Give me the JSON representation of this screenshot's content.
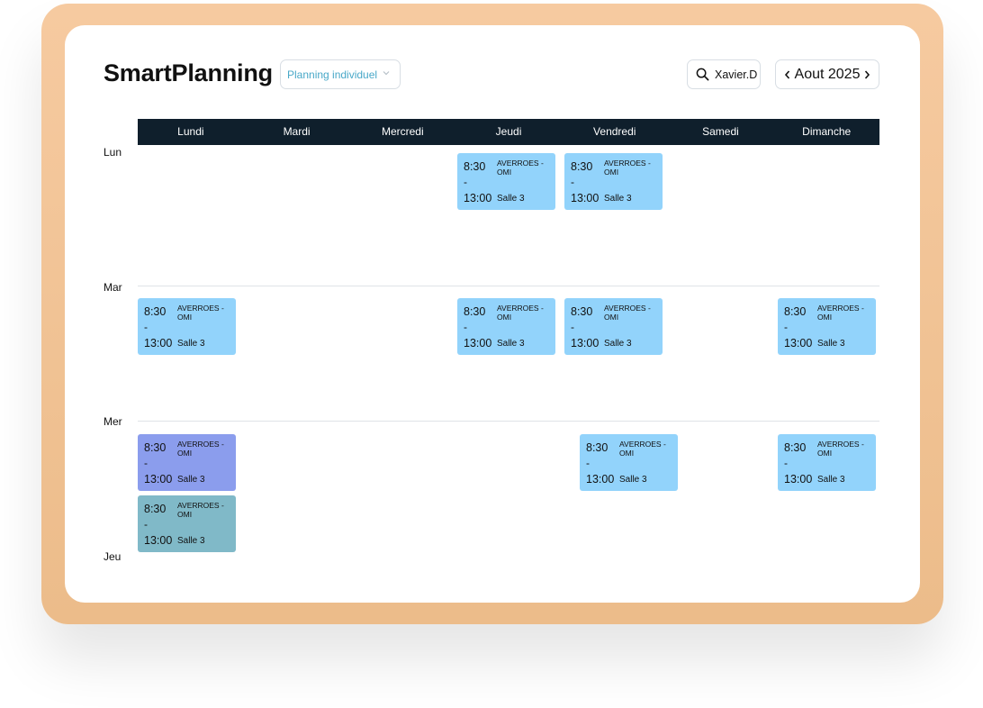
{
  "app": {
    "title": "SmartPlanning"
  },
  "view_select": {
    "selected": "Planning individuel"
  },
  "search": {
    "label": "Xavier.D",
    "icon": "search-icon"
  },
  "month_nav": {
    "label": "Aout 2025",
    "prev_icon": "chevron-left-icon",
    "next_icon": "chevron-right-icon"
  },
  "days": [
    "Lundi",
    "Mardi",
    "Mercredi",
    "Jeudi",
    "Vendredi",
    "Samedi",
    "Dimanche"
  ],
  "rows": [
    "Lun",
    "Mar",
    "Mer",
    "Jeu"
  ],
  "colors": {
    "frame": "#f6caa0",
    "header": "#0f1f2c",
    "event_default": "#92d3fb",
    "event_violet": "#8b9ded",
    "event_teal": "#80b9c8",
    "accent_text": "#48a8c8"
  },
  "events": [
    {
      "row": "Lun",
      "day": "Jeudi",
      "start": "8:30",
      "dash": "-",
      "end": "13:00",
      "title": "AVERROES - OMI",
      "room": "Salle 3",
      "color": "event_default"
    },
    {
      "row": "Lun",
      "day": "Vendredi",
      "start": "8:30",
      "dash": "-",
      "end": "13:00",
      "title": "AVERROES - OMI",
      "room": "Salle 3",
      "color": "event_default"
    },
    {
      "row": "Mar",
      "day": "Lundi",
      "start": "8:30",
      "dash": "-",
      "end": "13:00",
      "title": "AVERROES - OMI",
      "room": "Salle 3",
      "color": "event_default"
    },
    {
      "row": "Mar",
      "day": "Jeudi",
      "start": "8:30",
      "dash": "-",
      "end": "13:00",
      "title": "AVERROES - OMI",
      "room": "Salle 3",
      "color": "event_default"
    },
    {
      "row": "Mar",
      "day": "Vendredi",
      "start": "8:30",
      "dash": "-",
      "end": "13:00",
      "title": "AVERROES - OMI",
      "room": "Salle 3",
      "color": "event_default"
    },
    {
      "row": "Mar",
      "day": "Dimanche",
      "start": "8:30",
      "dash": "-",
      "end": "13:00",
      "title": "AVERROES - OMI",
      "room": "Salle 3",
      "color": "event_default"
    },
    {
      "row": "Mer",
      "day": "Lundi",
      "start": "8:30",
      "dash": "-",
      "end": "13:00",
      "title": "AVERROES - OMI",
      "room": "Salle 3",
      "color": "event_violet"
    },
    {
      "row": "Mer",
      "day": "Lundi",
      "start": "8:30",
      "dash": "-",
      "end": "13:00",
      "title": "AVERROES - OMI",
      "room": "Salle 3",
      "color": "event_teal"
    },
    {
      "row": "Mer",
      "day": "Vendredi",
      "start": "8:30",
      "dash": "-",
      "end": "13:00",
      "title": "AVERROES - OMI",
      "room": "Salle 3",
      "color": "event_default"
    },
    {
      "row": "Mer",
      "day": "Dimanche",
      "start": "8:30",
      "dash": "-",
      "end": "13:00",
      "title": "AVERROES - OMI",
      "room": "Salle 3",
      "color": "event_default"
    }
  ]
}
